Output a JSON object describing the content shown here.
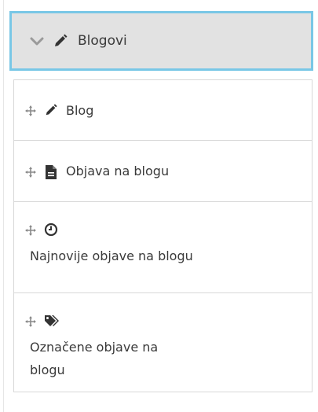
{
  "header": {
    "title": "Blogovi",
    "accent": "#79c7e6"
  },
  "items": [
    {
      "label": "Blog",
      "icon": "pencil-icon"
    },
    {
      "label": "Objava na blogu",
      "icon": "document-icon"
    },
    {
      "label": "Najnovije objave na blogu",
      "icon": "clock-icon"
    },
    {
      "label_line1": "Označene objave na",
      "label_line2": "blogu",
      "icon": "tags-icon"
    }
  ]
}
